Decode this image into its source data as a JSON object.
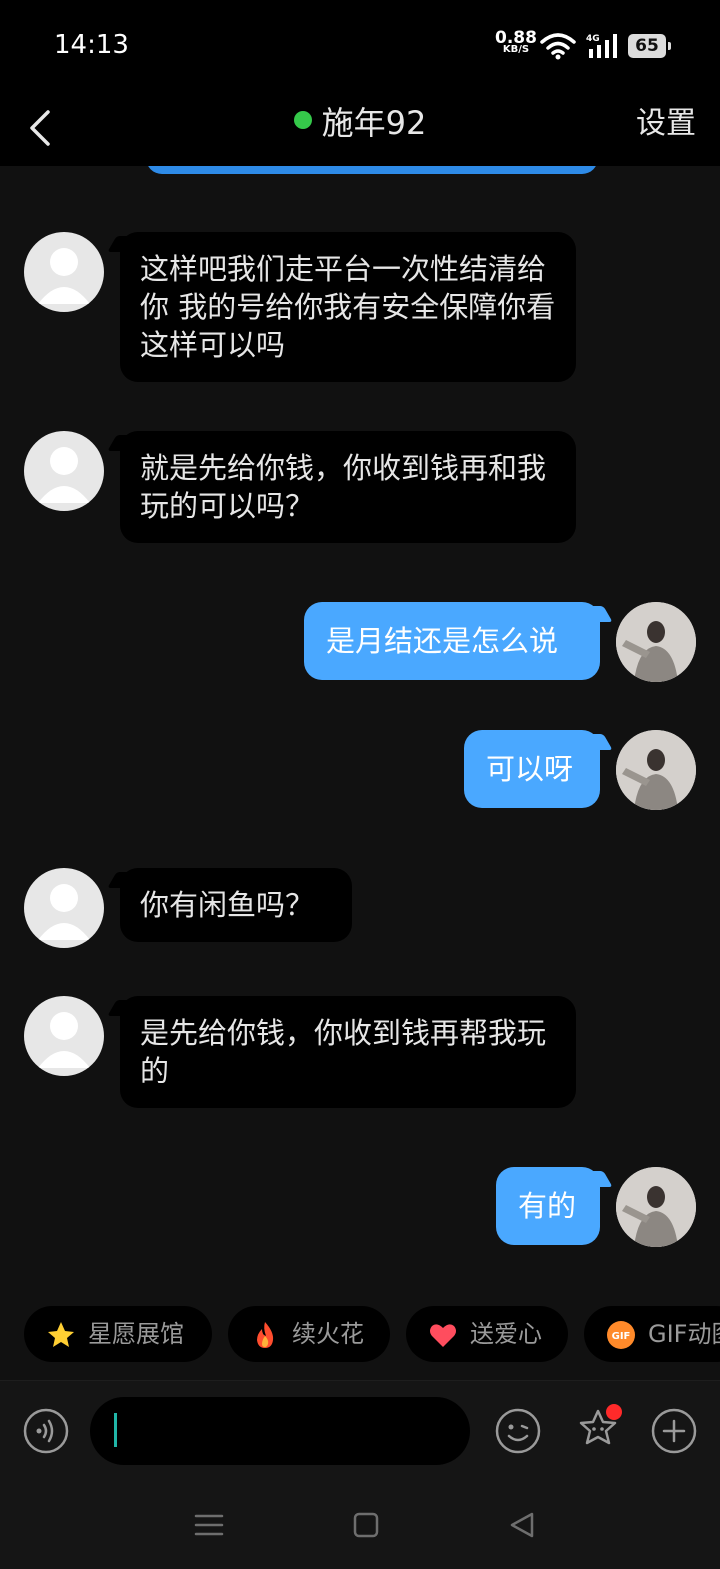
{
  "status_bar": {
    "time": "14:13",
    "net_speed_value": "0.88",
    "net_speed_unit": "KB/S",
    "network_type": "4G",
    "battery_level": "65"
  },
  "header": {
    "title": "施年92",
    "settings_label": "设置",
    "online_color": "#35c94a"
  },
  "messages": [
    {
      "direction": "in",
      "text": "这样吧我们走平台一次性结清给你 我的号给你我有安全保障你看这样可以吗"
    },
    {
      "direction": "in",
      "text": "就是先给你钱，你收到钱再和我玩的可以吗？"
    },
    {
      "direction": "out",
      "text": "是月结还是怎么说"
    },
    {
      "direction": "out",
      "text": "可以呀"
    },
    {
      "direction": "in",
      "text": "你有闲鱼吗？"
    },
    {
      "direction": "in",
      "text": "是先给你钱，你收到钱再帮我玩的"
    },
    {
      "direction": "out",
      "text": "有的"
    }
  ],
  "quick_actions": [
    {
      "label": "星愿展馆",
      "icon": "star-icon"
    },
    {
      "label": "续火花",
      "icon": "flame-icon"
    },
    {
      "label": "送爱心",
      "icon": "heart-icon"
    },
    {
      "label": "GIF动图",
      "icon": "gif-icon"
    }
  ],
  "gif_badge": "GIF",
  "input": {
    "value": ""
  },
  "colors": {
    "background": "#111111",
    "outgoing_bubble": "#4aa8ff",
    "incoming_bubble": "#000000",
    "notification_dot": "#ff2a2a"
  }
}
